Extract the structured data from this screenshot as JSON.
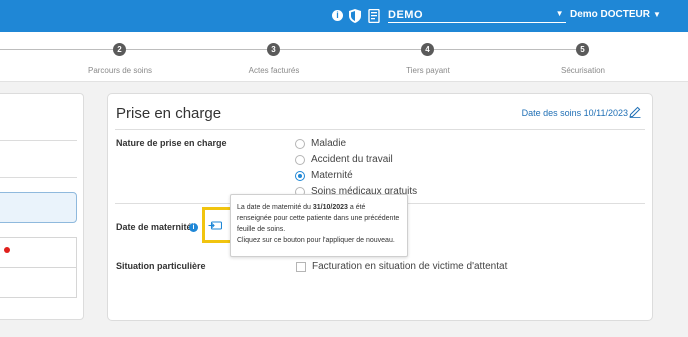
{
  "topbar": {
    "info_icon": "info-icon",
    "shield_icon": "shield-icon",
    "document_icon": "document-icon",
    "establishment_value": "DEMO",
    "user_label": "Demo DOCTEUR",
    "color": "#1f87d6"
  },
  "stepper": {
    "steps": [
      {
        "number": "2",
        "label": "Parcours de soins"
      },
      {
        "number": "3",
        "label": "Actes facturés"
      },
      {
        "number": "4",
        "label": "Tiers payant"
      },
      {
        "number": "5",
        "label": "Sécurisation"
      }
    ]
  },
  "card": {
    "title": "Prise en charge",
    "date_soins": "Date des soins 10/11/2023",
    "nature_label": "Nature de prise en charge",
    "nature_options": [
      {
        "label": "Maladie",
        "checked": false
      },
      {
        "label": "Accident du travail",
        "checked": false
      },
      {
        "label": "Maternité",
        "checked": true
      },
      {
        "label": "Soins médicaux gratuits",
        "checked": false
      }
    ],
    "maternite_label": "Date de maternité",
    "situation_label": "Situation particulière",
    "victime_label": "Facturation en situation de victime d'attentat"
  },
  "tooltip": {
    "part1": "La date de maternité du ",
    "date": "31/10/2023",
    "part2": " a été renseignée pour cette patiente dans une précédente feuille de soins.",
    "line2": "Cliquez sur ce bouton pour l'appliquer de nouveau."
  },
  "colors": {
    "accent": "#1f87d6",
    "highlight": "#f1c40f",
    "alert_dot": "#e0201c"
  }
}
